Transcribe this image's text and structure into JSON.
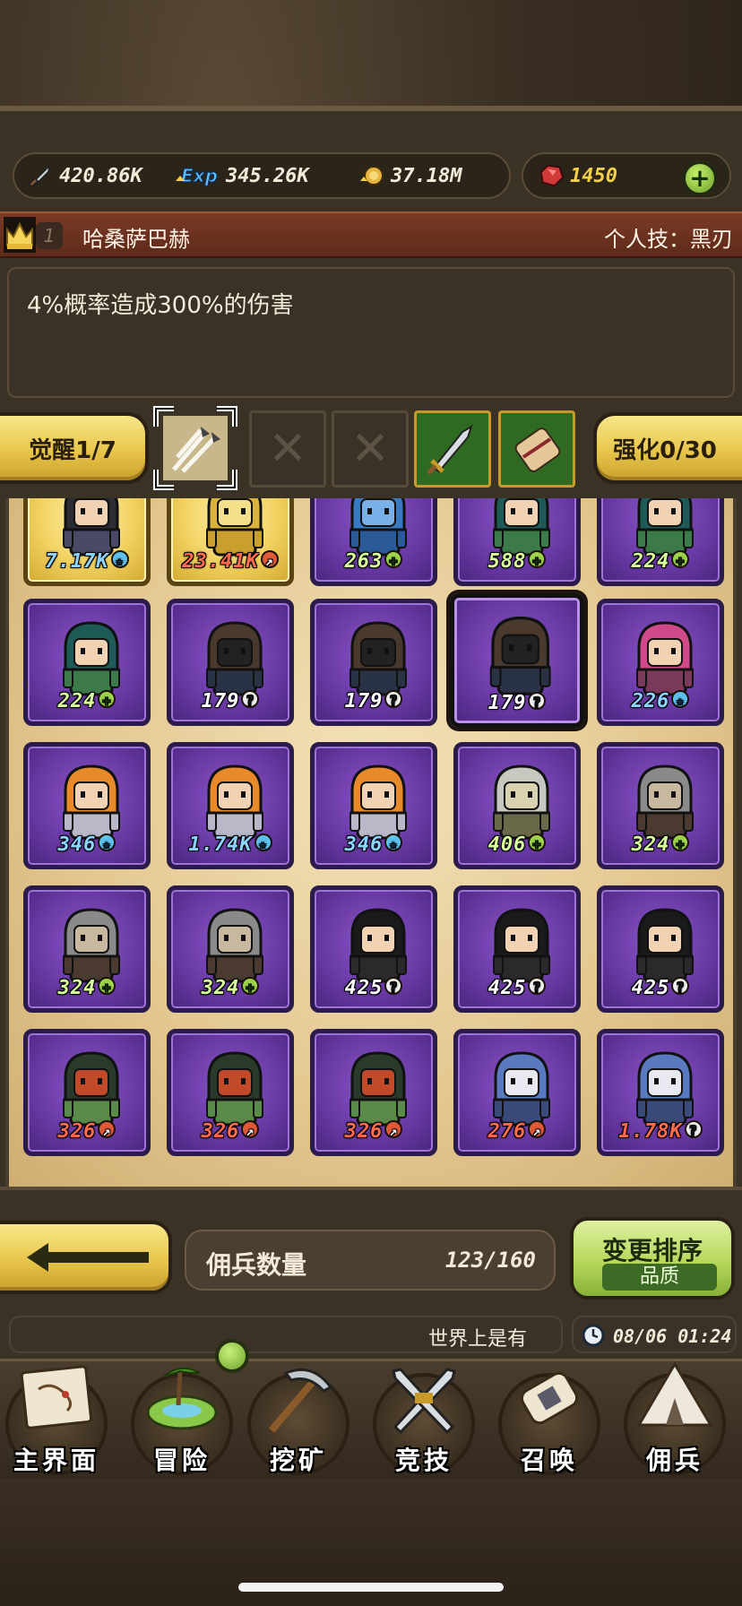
{
  "resources": {
    "attack": "420.86K",
    "exp_icon_text": "Exp",
    "exp": "345.26K",
    "gold": "37.18M",
    "gems": "1450"
  },
  "hero": {
    "level": "1",
    "name": "哈桑萨巴赫",
    "skill": "个人技：黑刃",
    "description": "4%概率造成300%的伤害"
  },
  "awaken": {
    "awaken_label": "觉醒1/7",
    "enhance_label": "强化0/30"
  },
  "mercenaries": [
    {
      "value": "7.17K",
      "badge": "star",
      "frame": "gold",
      "color": "blue",
      "sword": true
    },
    {
      "value": "23.41K",
      "badge": "arrow",
      "frame": "gold",
      "color": "red",
      "sword": true
    },
    {
      "value": "263",
      "badge": "plus",
      "frame": "purple",
      "color": "green",
      "sword": false
    },
    {
      "value": "588",
      "badge": "plus",
      "frame": "purple",
      "color": "green",
      "sword": false
    },
    {
      "value": "224",
      "badge": "plus",
      "frame": "purple",
      "color": "green",
      "sword": false
    },
    {
      "value": "224",
      "badge": "plus",
      "frame": "purple",
      "color": "green",
      "sword": false
    },
    {
      "value": "179",
      "badge": "question",
      "frame": "purple",
      "color": "white",
      "sword": false
    },
    {
      "value": "179",
      "badge": "question",
      "frame": "purple",
      "color": "white",
      "sword": false
    },
    {
      "value": "179",
      "badge": "question",
      "frame": "purple",
      "color": "white",
      "sword": false,
      "selected": true
    },
    {
      "value": "226",
      "badge": "star",
      "frame": "purple",
      "color": "blue",
      "sword": false
    },
    {
      "value": "346",
      "badge": "star",
      "frame": "purple",
      "color": "blue",
      "sword": false
    },
    {
      "value": "1.74K",
      "badge": "star",
      "frame": "purple",
      "color": "blue",
      "sword": false
    },
    {
      "value": "346",
      "badge": "star",
      "frame": "purple",
      "color": "blue",
      "sword": false
    },
    {
      "value": "406",
      "badge": "plus",
      "frame": "purple",
      "color": "green",
      "sword": false
    },
    {
      "value": "324",
      "badge": "plus",
      "frame": "purple",
      "color": "green",
      "sword": false
    },
    {
      "value": "324",
      "badge": "plus",
      "frame": "purple",
      "color": "green",
      "sword": false
    },
    {
      "value": "324",
      "badge": "plus",
      "frame": "purple",
      "color": "green",
      "sword": false
    },
    {
      "value": "425",
      "badge": "question",
      "frame": "purple",
      "color": "white",
      "sword": false
    },
    {
      "value": "425",
      "badge": "question",
      "frame": "purple",
      "color": "white",
      "sword": false
    },
    {
      "value": "425",
      "badge": "question",
      "frame": "purple",
      "color": "white",
      "sword": false
    },
    {
      "value": "326",
      "badge": "arrow",
      "frame": "purple",
      "color": "red",
      "sword": false
    },
    {
      "value": "326",
      "badge": "arrow",
      "frame": "purple",
      "color": "red",
      "sword": false
    },
    {
      "value": "326",
      "badge": "arrow",
      "frame": "purple",
      "color": "red",
      "sword": false
    },
    {
      "value": "276",
      "badge": "arrow",
      "frame": "purple",
      "color": "red",
      "sword": false
    },
    {
      "value": "1.78K",
      "badge": "question",
      "frame": "purple",
      "color": "red",
      "sword": false
    }
  ],
  "footer": {
    "count_label": "佣兵数量",
    "count_value": "123/160",
    "sort_label": "变更排序",
    "sort_sub": "品质",
    "ticker": "世界上是有",
    "time": "08/06 01:24"
  },
  "nav": [
    {
      "label": "主界面",
      "icon": "map-scroll-icon"
    },
    {
      "label": "冒险",
      "icon": "island-icon"
    },
    {
      "label": "挖矿",
      "icon": "pickaxe-icon"
    },
    {
      "label": "竞技",
      "icon": "crossed-swords-icon"
    },
    {
      "label": "召唤",
      "icon": "summon-scroll-icon"
    },
    {
      "label": "佣兵",
      "icon": "tent-icon"
    }
  ],
  "colors": {
    "card_purple": "#6a3aa6",
    "card_gold": "#f2d160",
    "accent_yellow": "#e8c64a",
    "accent_green": "#b7d85a",
    "name_bar": "#6e3220"
  }
}
